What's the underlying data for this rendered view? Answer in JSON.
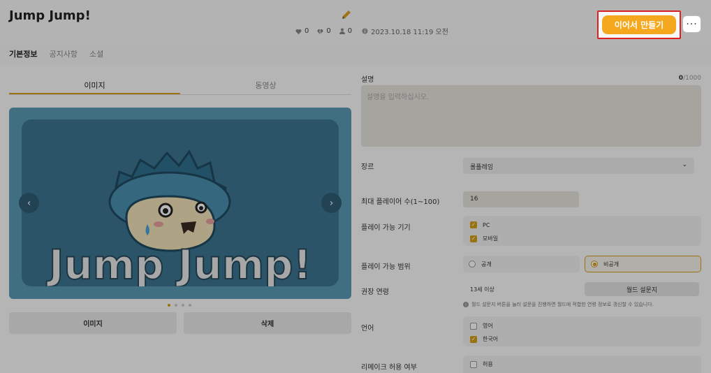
{
  "header": {
    "title": "Jump Jump!",
    "likes": "0",
    "dislikes": "0",
    "players": "0",
    "date": "2023.10.18 11:19 오전",
    "continue_label": "이어서 만들기",
    "more_label": "···"
  },
  "top_tabs": [
    "기본정보",
    "공지사항",
    "소셜"
  ],
  "media": {
    "tabs": [
      "이미지",
      "동영상"
    ],
    "image_button": "이미지",
    "delete_button": "삭제",
    "banner_text": "Jump Jump!"
  },
  "form": {
    "description_label": "설명",
    "description_count": "0",
    "description_max": "/1000",
    "description_placeholder": "설명을 입력하십시오.",
    "genre_label": "장르",
    "genre_value": "롤플레잉",
    "max_players_label": "최대 플레이어 수(1~100)",
    "max_players_value": "16",
    "devices_label": "플레이 가능 기기",
    "devices": [
      {
        "label": "PC",
        "checked": true
      },
      {
        "label": "모바일",
        "checked": true
      }
    ],
    "scope_label": "플레이 가능 범위",
    "scope_options": [
      {
        "label": "공개",
        "selected": false
      },
      {
        "label": "비공개",
        "selected": true
      }
    ],
    "age_label": "권장 연령",
    "age_value": "13세 이상",
    "survey_button": "월드 설문지",
    "survey_note": "월드 설문지 버튼을 눌러 설문을 진행하면 월드에 적합한 연령 정보로 갱신할 수 있습니다.",
    "language_label": "언어",
    "languages": [
      {
        "label": "영어",
        "checked": false
      },
      {
        "label": "한국어",
        "checked": true
      }
    ],
    "remake_label": "리메이크 허용 여부",
    "remake_option": {
      "label": "허용",
      "checked": false
    }
  },
  "colors": {
    "accent": "#f5a81e",
    "highlight_border": "#e02020",
    "tab_underline": "#d4a017",
    "banner_bg": "#5a9ab5"
  }
}
